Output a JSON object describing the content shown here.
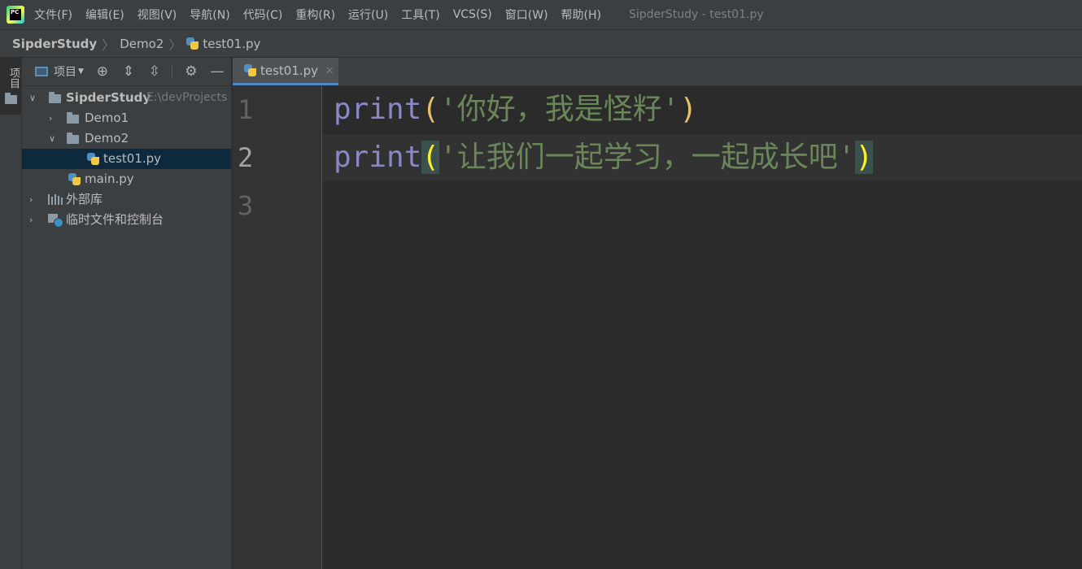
{
  "app": {
    "icon_label": "PC",
    "window_title": "SipderStudy - test01.py"
  },
  "menu": [
    "文件(F)",
    "编辑(E)",
    "视图(V)",
    "导航(N)",
    "代码(C)",
    "重构(R)",
    "运行(U)",
    "工具(T)",
    "VCS(S)",
    "窗口(W)",
    "帮助(H)"
  ],
  "breadcrumb": {
    "root": "SipderStudy",
    "folder": "Demo2",
    "file": "test01.py"
  },
  "toolstrip": {
    "project_label": "项目"
  },
  "project_panel": {
    "title": "项目",
    "icons": [
      "locate-icon",
      "expand-all-icon",
      "collapse-all-icon",
      "gear-icon",
      "minimize-icon"
    ],
    "tree": {
      "root": {
        "name": "SipderStudy",
        "path": "E:\\devProjects"
      },
      "demo1": "Demo1",
      "demo2": "Demo2",
      "test01": "test01.py",
      "main": "main.py",
      "external_libs": "外部库",
      "scratches": "临时文件和控制台"
    }
  },
  "editor": {
    "tab": {
      "label": "test01.py",
      "close": "×"
    },
    "line_numbers": [
      "1",
      "2",
      "3"
    ],
    "lines": [
      {
        "keyword": "print",
        "open": "(",
        "string": "'你好，我是怪籽'",
        "close": ")"
      },
      {
        "keyword": "print",
        "open": "(",
        "string": "'让我们一起学习，一起成长吧'",
        "close": ")"
      }
    ]
  },
  "colors": {
    "keyword": "#8888c6",
    "string": "#6a8759",
    "paren": "#e8bf6a",
    "selection": "#0d293e",
    "tab_underline": "#4a88c7"
  }
}
